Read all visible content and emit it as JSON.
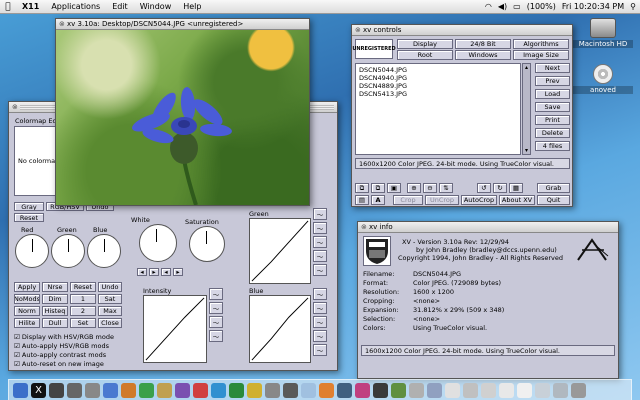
{
  "menubar": {
    "apple": "",
    "items": [
      "X11",
      "Applications",
      "Edit",
      "Window",
      "Help"
    ],
    "battery": "(100%)",
    "clock": "Fri 10:20:34 PM"
  },
  "desktop": {
    "icons": [
      {
        "label": "Macintosh HD",
        "icon": "hard-drive-icon"
      },
      {
        "label": "anoved",
        "icon": "disc-icon"
      }
    ]
  },
  "image_window": {
    "title": "xv 3.10a: Desktop/DSCN5044.JPG <unregistered>"
  },
  "colormap_window": {
    "title": "Colormap Editor",
    "no_colormap": "No colormap",
    "tabs": [
      "Gray",
      "RGB/HSV",
      "Undo",
      "Reset"
    ],
    "dial_labels": [
      "Red",
      "Green",
      "Blue"
    ],
    "hsv_labels": [
      "White",
      "Saturation"
    ],
    "intensity_label": "Intensity",
    "green_label": "Green",
    "blue_label": "Blue",
    "button_grid": [
      [
        "Apply",
        "Nrse",
        "Reset",
        "Undo"
      ],
      [
        "NoMods",
        "Dim",
        "1",
        "Sat"
      ],
      [
        "Norm",
        "Histeq",
        "2",
        "Max"
      ],
      [
        "Hilite",
        "Dull",
        "Set",
        "Close"
      ]
    ],
    "checkboxes": [
      "Display with HSV/RGB mode",
      "Auto-apply HSV/RGB mods",
      "Auto-apply contrast mods",
      "Auto-reset on new image"
    ]
  },
  "controls_window": {
    "title": "xv controls",
    "logo": "UNREGISTERED",
    "top_buttons": [
      "Display",
      "24/8 Bit",
      "Algorithms",
      "Root",
      "Windows",
      "Image Size"
    ],
    "files": [
      "DSCN5044.JPG",
      "DSCN4940.JPG",
      "DSCN4889.JPG",
      "DSCN5413.JPG"
    ],
    "side_buttons": [
      "Next",
      "Prev",
      "Load",
      "Save",
      "Print",
      "Delete",
      "4 files"
    ],
    "status": "1600x1200 Color JPEG.  24-bit mode.  Using TrueColor visual.",
    "bottom_buttons": [
      "Grab",
      "Crop",
      "UnCrop",
      "AutoCrop",
      "About XV",
      "Quit"
    ]
  },
  "info_window": {
    "title": "xv info",
    "version_line": "XV  -  Version 3.10a  Rev: 12/29/94",
    "author_line": "by John Bradley  (bradley@dccs.upenn.edu)",
    "copyright_line": "Copyright 1994, John Bradley  -  All Rights Reserved",
    "rows": [
      {
        "k": "Filename:",
        "v": "DSCN5044.JPG"
      },
      {
        "k": "Format:",
        "v": "Color JPEG. (729089 bytes)"
      },
      {
        "k": "Resolution:",
        "v": "1600 x 1200"
      },
      {
        "k": "Cropping:",
        "v": "<none>"
      },
      {
        "k": "Expansion:",
        "v": "31.812% x 29% (509 x 348)"
      },
      {
        "k": "Selection:",
        "v": "<none>"
      },
      {
        "k": "Colors:",
        "v": "Using TrueColor visual."
      }
    ],
    "status": "1600x1200 Color JPEG.  24-bit mode.  Using TrueColor visual."
  }
}
